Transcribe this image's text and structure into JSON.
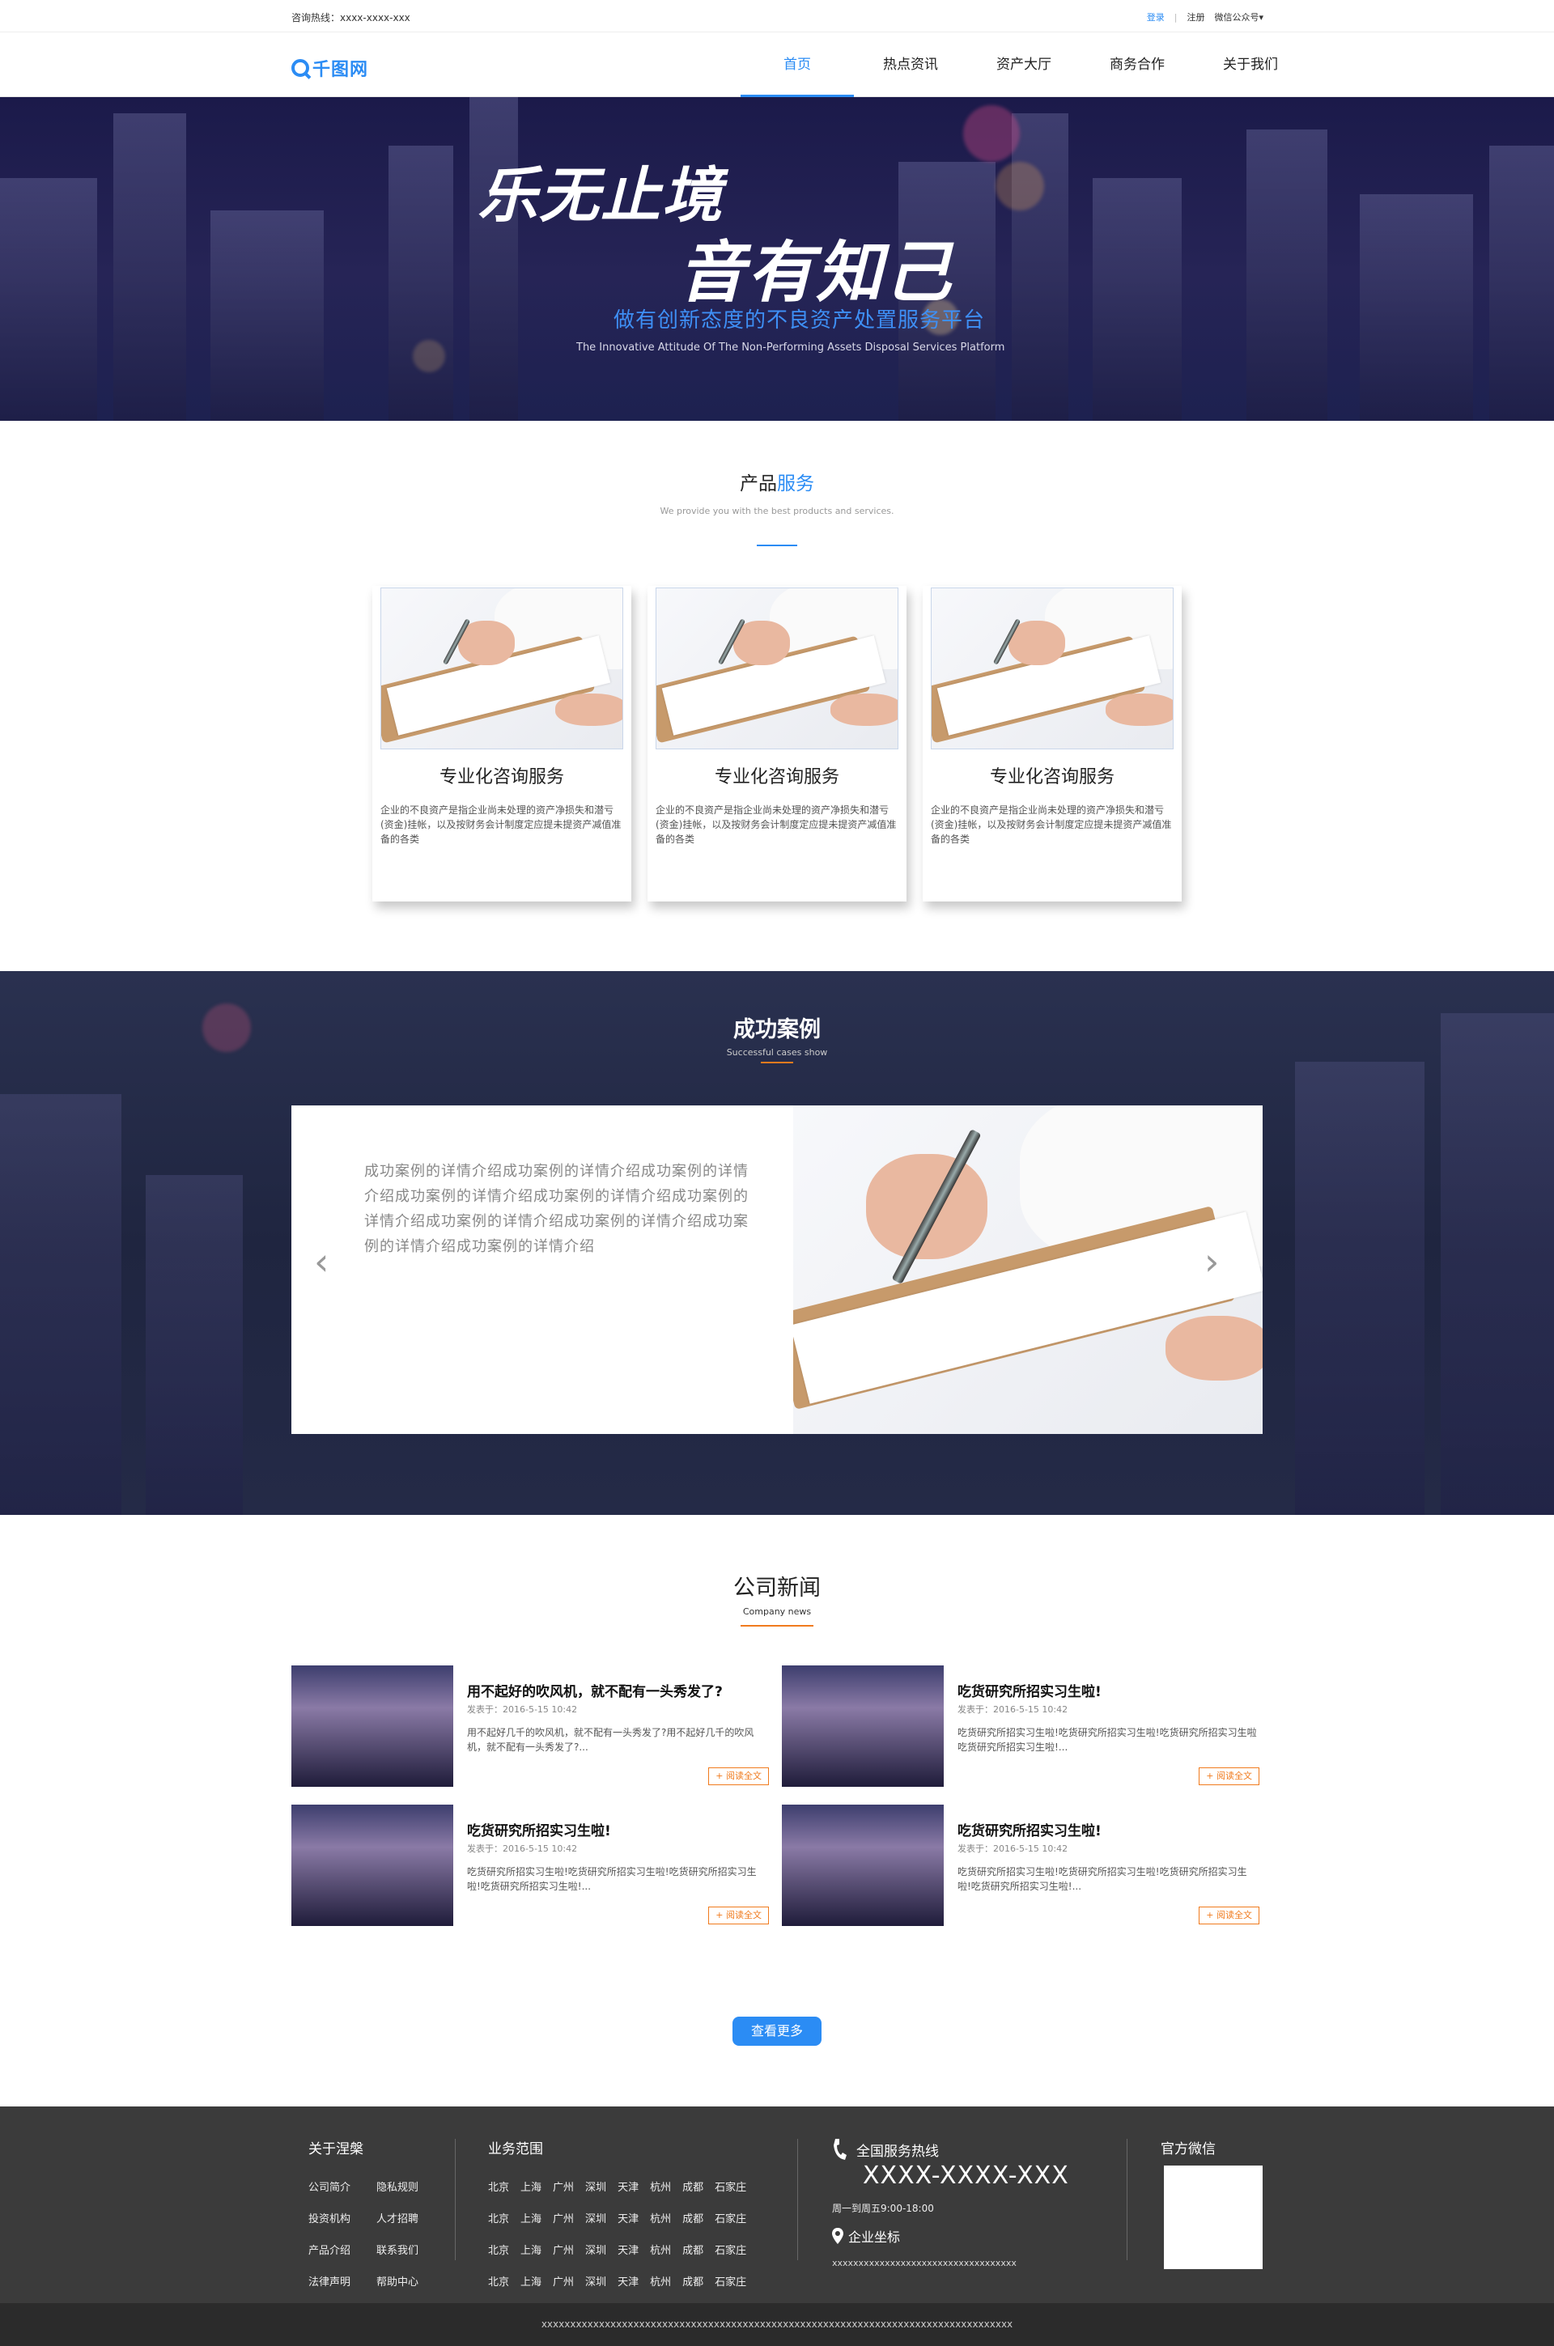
{
  "topbar": {
    "hotline": "咨询热线：xxxx-xxxx-xxx",
    "login": "登录",
    "divider": "|",
    "register": "注册",
    "wechat": "微信公众号▾"
  },
  "nav": {
    "logo_text": "千图网",
    "items": [
      {
        "label": "首页",
        "active": true
      },
      {
        "label": "热点资讯"
      },
      {
        "label": "资产大厅"
      },
      {
        "label": "商务合作"
      },
      {
        "label": "关于我们"
      }
    ]
  },
  "hero": {
    "line1": "乐无止境",
    "line2": "音有知己",
    "slogan": "做有创新态度的不良资产处置服务平台",
    "english": "The Innovative Attitude Of The Non-Performing Assets Disposal Services Platform"
  },
  "products": {
    "title_a": "产品",
    "title_b": "服务",
    "subtitle": "We provide you with the best products and services.",
    "cards": [
      {
        "title": "专业化咨询服务",
        "desc": "企业的不良资产是指企业尚未处理的资产净损失和潜亏(资金)挂帐，以及按财务会计制度定应提未提资产减值准备的各类"
      },
      {
        "title": "专业化咨询服务",
        "desc": "企业的不良资产是指企业尚未处理的资产净损失和潜亏(资金)挂帐，以及按财务会计制度定应提未提资产减值准备的各类"
      },
      {
        "title": "专业化咨询服务",
        "desc": "企业的不良资产是指企业尚未处理的资产净损失和潜亏(资金)挂帐，以及按财务会计制度定应提未提资产减值准备的各类"
      }
    ]
  },
  "cases": {
    "title": "成功案例",
    "subtitle": "Successful cases show",
    "text": "成功案例的详情介绍成功案例的详情介绍成功案例的详情介绍成功案例的详情介绍成功案例的详情介绍成功案例的详情介绍成功案例的详情介绍成功案例的详情介绍成功案例的详情介绍成功案例的详情介绍",
    "prev": "‹",
    "next": "›"
  },
  "news": {
    "title": "公司新闻",
    "subtitle": "Company news",
    "read_more": "+ 阅读全文",
    "items": [
      {
        "title": "用不起好的吹风机，就不配有一头秀发了?",
        "date": "发表于：2016-5-15 10:42",
        "desc": "用不起好几千的吹风机，就不配有一头秀发了?用不起好几千的吹风机，就不配有一头秀发了?..."
      },
      {
        "title": "吃货研究所招实习生啦!",
        "date": "发表于：2016-5-15 10:42",
        "desc": "吃货研究所招实习生啦!吃货研究所招实习生啦!吃货研究所招实习生啦吃货研究所招实习生啦!..."
      },
      {
        "title": "吃货研究所招实习生啦!",
        "date": "发表于：2016-5-15 10:42",
        "desc": "吃货研究所招实习生啦!吃货研究所招实习生啦!吃货研究所招实习生啦!吃货研究所招实习生啦!..."
      },
      {
        "title": "吃货研究所招实习生啦!",
        "date": "发表于：2016-5-15 10:42",
        "desc": "吃货研究所招实习生啦!吃货研究所招实习生啦!吃货研究所招实习生啦!吃货研究所招实习生啦!..."
      }
    ],
    "more_button": "查看更多"
  },
  "footer": {
    "about_title": "关于涅槃",
    "about_links": [
      [
        "公司简介",
        "隐私规则"
      ],
      [
        "投资机构",
        "人才招聘"
      ],
      [
        "产品介绍",
        "联系我们"
      ],
      [
        "法律声明",
        "帮助中心"
      ]
    ],
    "scope_title": "业务范围",
    "cities": [
      "北京",
      "上海",
      "广州",
      "深圳",
      "天津",
      "杭州",
      "成都",
      "石家庄"
    ],
    "service_title": "全国服务热线",
    "service_phone": "XXXX-XXXX-XXX",
    "service_hours": "周一到周五9:00-18:00",
    "location_title": "企业坐标",
    "location_text": "xxxxxxxxxxxxxxxxxxxxxxxxxxxxxxxxxxx",
    "wechat_title": "官方微信",
    "copyright": "xxxxxxxxxxxxxxxxxxxxxxxxxxxxxxxxxxxxxxxxxxxxxxxxxxxxxxxxxxxxxxxxxxxxxxxxxxxxxxxxxx"
  },
  "colors": {
    "accent": "#2b8cf4",
    "orange": "#f07b1e",
    "footer_bg": "#3b3b3b"
  }
}
